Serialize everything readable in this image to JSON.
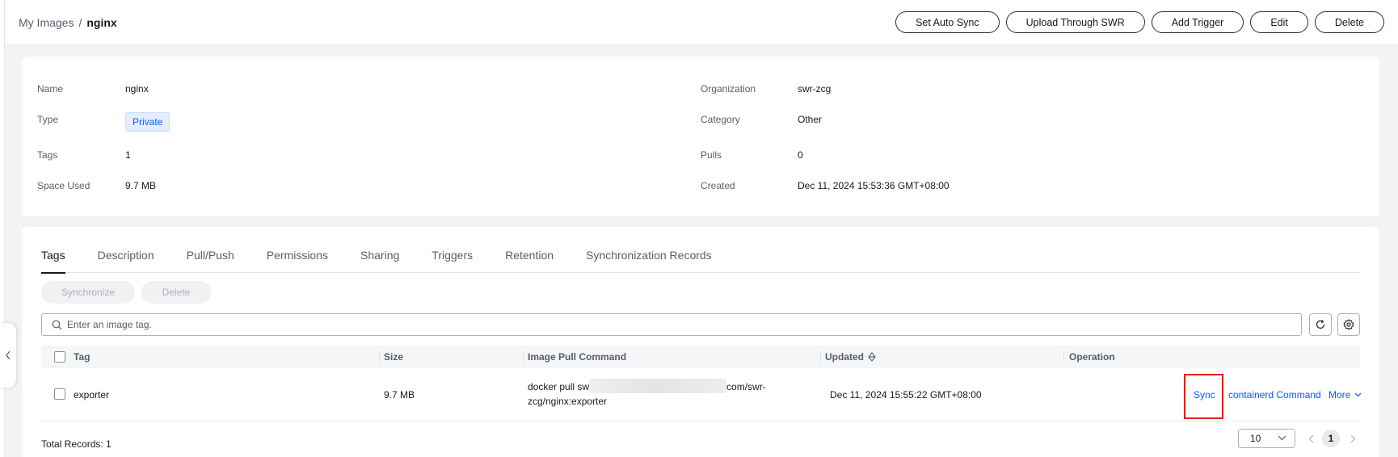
{
  "breadcrumb": {
    "parent": "My Images",
    "separator": "/",
    "current": "nginx"
  },
  "header_actions": [
    "Set Auto Sync",
    "Upload Through SWR",
    "Add Trigger",
    "Edit",
    "Delete"
  ],
  "info": {
    "name_label": "Name",
    "name_value": "nginx",
    "type_label": "Type",
    "type_value": "Private",
    "tags_label": "Tags",
    "tags_value": "1",
    "space_label": "Space Used",
    "space_value": "9.7 MB",
    "org_label": "Organization",
    "org_value": "swr-zcg",
    "category_label": "Category",
    "category_value": "Other",
    "pulls_label": "Pulls",
    "pulls_value": "0",
    "created_label": "Created",
    "created_value": "Dec 11, 2024 15:53:36 GMT+08:00"
  },
  "tabs": [
    "Tags",
    "Description",
    "Pull/Push",
    "Permissions",
    "Sharing",
    "Triggers",
    "Retention",
    "Synchronization Records"
  ],
  "active_tab": "Tags",
  "toolbar": {
    "synchronize_label": "Synchronize",
    "delete_label": "Delete"
  },
  "search": {
    "placeholder": "Enter an image tag."
  },
  "table": {
    "columns": [
      "Tag",
      "Size",
      "Image Pull Command",
      "Updated",
      "Operation"
    ],
    "rows": [
      {
        "tag": "exporter",
        "size": "9.7 MB",
        "pull_command_line1_start": "docker pull sw",
        "pull_command_line1_end": "com/swr-",
        "pull_command_line2": "zcg/nginx:exporter",
        "updated": "Dec 11, 2024 15:55:22 GMT+08:00",
        "op_sync": "Sync",
        "op_containerd": "containerd Command",
        "op_more": "More"
      }
    ]
  },
  "footer": {
    "total": "Total Records: 1",
    "page_size": "10",
    "current_page": "1"
  },
  "colors": {
    "accent": "#0a59f7",
    "highlight": "#e02020",
    "text": "#191919",
    "muted": "#575d6c"
  }
}
